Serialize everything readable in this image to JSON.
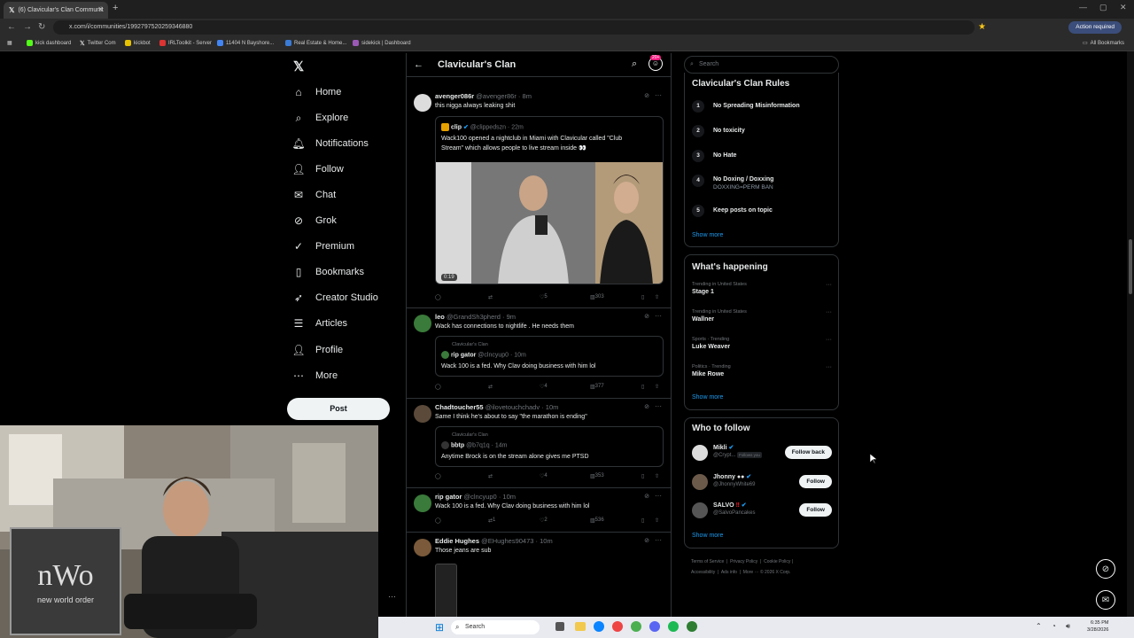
{
  "browser": {
    "tab_title": "(6) Clavicular's Clan Communit",
    "url": "x.com/i/communities/1992797520259346880",
    "action_required": "Action required",
    "all_bookmarks": "All Bookmarks",
    "bookmarks": [
      "kick dashboard",
      "Twitter Com",
      "kickbot",
      "IRLToolkit - Server",
      "11404 N Bayshore...",
      "Real Estate & Home...",
      "sidekick | Dashboard"
    ]
  },
  "sidebar": {
    "items": [
      {
        "label": "Home",
        "icon": "home-icon"
      },
      {
        "label": "Explore",
        "icon": "search-icon"
      },
      {
        "label": "Notifications",
        "icon": "bell-icon"
      },
      {
        "label": "Follow",
        "icon": "follow-icon"
      },
      {
        "label": "Chat",
        "icon": "mail-icon"
      },
      {
        "label": "Grok",
        "icon": "grok-icon"
      },
      {
        "label": "Premium",
        "icon": "premium-icon"
      },
      {
        "label": "Bookmarks",
        "icon": "bookmark-icon"
      },
      {
        "label": "Creator Studio",
        "icon": "rocket-icon"
      },
      {
        "label": "Articles",
        "icon": "articles-icon"
      },
      {
        "label": "Profile",
        "icon": "profile-icon"
      },
      {
        "label": "More",
        "icon": "more-icon"
      }
    ],
    "post_label": "Post"
  },
  "feed": {
    "title": "Clavicular's Clan",
    "badge": "20+",
    "posts": [
      {
        "name": "avenger086r",
        "handle": "@avenger86r · 8m",
        "text": "this nigga always leaking shit",
        "quote": {
          "name": "clip",
          "handle": "@clippedszn · 22m",
          "text1": "Wack100 opened a nightclub in Miami with Clavicular called \"Club",
          "text2": "Stream\" which allows people to live stream inside 👀",
          "video_time": "0:19"
        },
        "likes": "5",
        "views": "303"
      },
      {
        "name": "leo",
        "handle": "@GrandSh3pherd · 9m",
        "text": "Wack has connections to nightlife . He needs them",
        "quote": {
          "community": "Clavicular's Clan",
          "name": "rip gator",
          "handle": "@clncyup0 · 10m",
          "text": "Wack 100 is a fed. Why Clav doing business with him lol"
        },
        "likes": "4",
        "views": "377"
      },
      {
        "name": "Chadtoucher55",
        "handle": "@ilovetouchchadv · 10m",
        "text": "Same I think he's about to say \"the marathon is ending\"",
        "quote": {
          "community": "Clavicular's Clan",
          "name": "bbtp",
          "handle": "@b7q1q · 14m",
          "text": "Anytime Brock is on the stream alone gives me PTSD"
        },
        "likes": "4",
        "views": "353"
      },
      {
        "name": "rip gator",
        "handle": "@clncyup0 · 10m",
        "text": "Wack 100 is a fed. Why Clav doing business with him lol",
        "retweets": "1",
        "likes": "2",
        "views": "536"
      },
      {
        "name": "Eddie Hughes",
        "handle": "@EHughes90473 · 10m",
        "text": "Those jeans are sub"
      }
    ]
  },
  "right": {
    "search_placeholder": "Search",
    "rules_title": "Clavicular's Clan Rules",
    "rules": [
      {
        "n": "1",
        "label": "No Spreading Misinformation",
        "sub": ""
      },
      {
        "n": "2",
        "label": "No toxicity",
        "sub": ""
      },
      {
        "n": "3",
        "label": "No Hate",
        "sub": ""
      },
      {
        "n": "4",
        "label": "No Doxing / Doxxing",
        "sub": "DOXXING=PERM BAN"
      },
      {
        "n": "5",
        "label": "Keep posts on topic",
        "sub": ""
      }
    ],
    "show_more": "Show more",
    "happening_title": "What's happening",
    "trends": [
      {
        "meta": "Trending in United States",
        "name": "Stage 1"
      },
      {
        "meta": "Trending in United States",
        "name": "Wallner"
      },
      {
        "meta": "Sports · Trending",
        "name": "Luke Weaver"
      },
      {
        "meta": "Politics · Trending",
        "name": "Mike Rowe"
      }
    ],
    "wtf_title": "Who to follow",
    "who_to_follow": [
      {
        "name": "Mikli",
        "handle": "@Crypt...",
        "follows_you": "Follows you",
        "button": "Follow back"
      },
      {
        "name": "Jhonny ●●",
        "handle": "@JhonnyWhite69",
        "button": "Follow"
      },
      {
        "name": "SALVO",
        "handle": "@SalvoPancakes",
        "button": "Follow"
      }
    ],
    "footer": [
      "Terms of Service",
      "Privacy Policy",
      "Cookie Policy",
      "Accessibility",
      "Ads info",
      "More ···",
      "© 2026 X Corp."
    ]
  },
  "taskbar": {
    "search": "Search",
    "time": "6:35 PM",
    "date": "3/28/2026"
  },
  "colors": {
    "accent": "#1d9bf0",
    "background": "#000000",
    "border": "#2f3336",
    "muted": "#71767b"
  }
}
